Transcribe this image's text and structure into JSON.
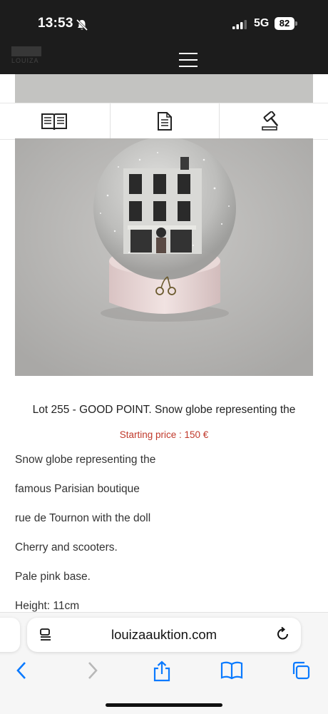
{
  "status": {
    "time": "13:53",
    "network": "5G",
    "battery": "82"
  },
  "header": {
    "logo_text": "LOUIZA"
  },
  "tabs": {
    "items": [
      {
        "icon": "book-icon"
      },
      {
        "icon": "document-icon"
      },
      {
        "icon": "gavel-icon"
      }
    ]
  },
  "lot": {
    "title": "Lot 255 - GOOD POINT. Snow globe representing the",
    "starting_price": "Starting price : 150 €",
    "description_lines": [
      "Snow globe representing the",
      "famous Parisian boutique",
      "rue de Tournon with the doll",
      "Cherry and scooters.",
      "Pale pink base.",
      "Height: 11cm"
    ]
  },
  "browser": {
    "url": "louizaauktion.com"
  },
  "colors": {
    "dark_bar": "#1c1c1c",
    "price_red": "#c0392b",
    "ios_blue": "#0a7aff"
  }
}
